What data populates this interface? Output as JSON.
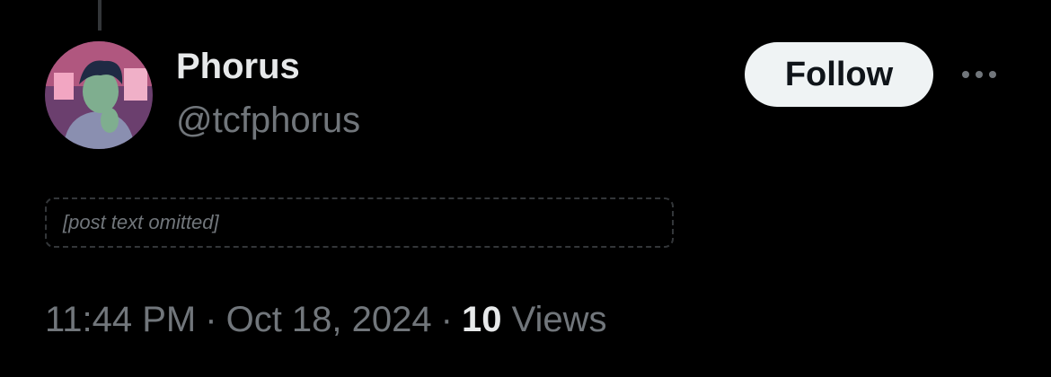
{
  "author": {
    "display_name": "Phorus",
    "handle": "@tcfphorus",
    "avatar_icon": "profile-avatar"
  },
  "actions": {
    "follow_label": "Follow",
    "more_icon": "more-horizontal-icon"
  },
  "post": {
    "text": ""
  },
  "metadata": {
    "time": "11:44 PM",
    "separator": "·",
    "date": "Oct 18, 2024",
    "views_count": "10",
    "views_label": "Views"
  },
  "colors": {
    "background": "#000000",
    "primary_text": "#e7e9ea",
    "secondary_text": "#71767b",
    "follow_button_bg": "#eff3f4",
    "follow_button_text": "#0f1419",
    "thread_line": "#333639"
  }
}
